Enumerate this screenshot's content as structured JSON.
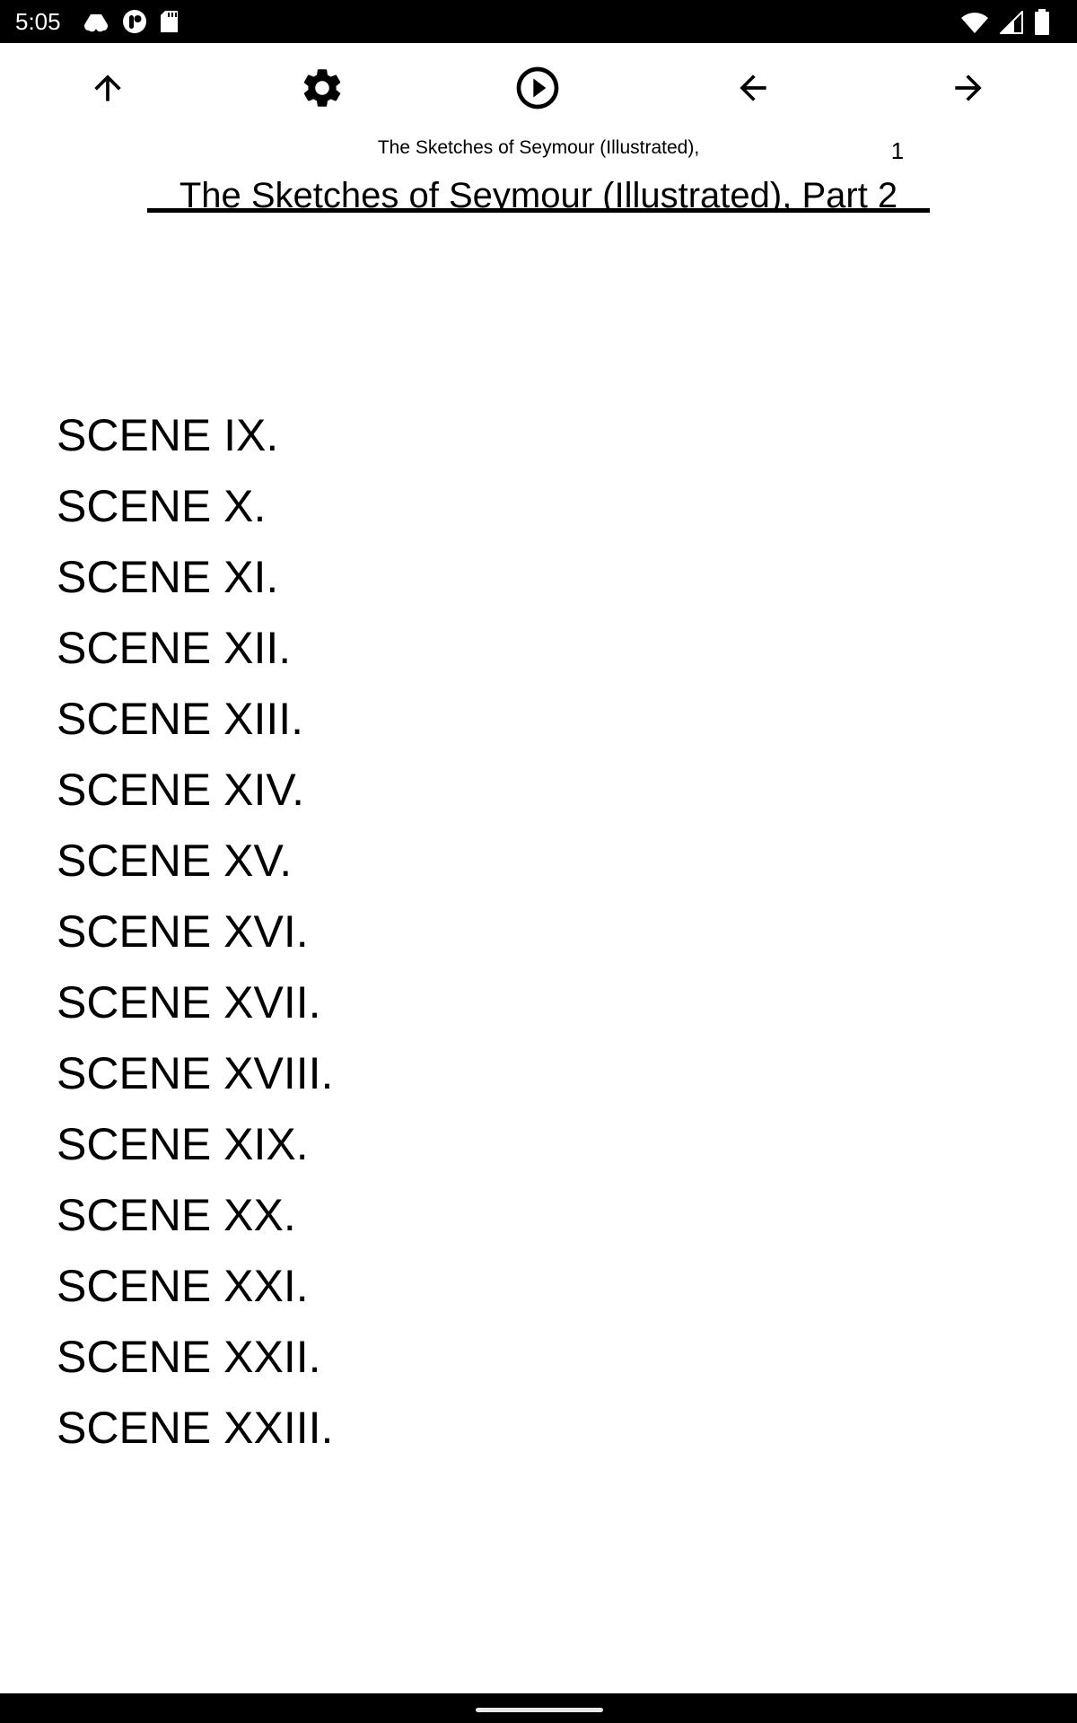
{
  "status_bar": {
    "time": "5:05",
    "left_icons": [
      "drive-icon",
      "app-notification-icon",
      "sd-card-icon"
    ],
    "right_icons": [
      "wifi-icon",
      "cellular-signal-icon",
      "battery-icon"
    ]
  },
  "toolbar": {
    "buttons": [
      {
        "name": "up-button",
        "icon": "arrow-up-icon"
      },
      {
        "name": "settings-button",
        "icon": "gear-icon"
      },
      {
        "name": "play-button",
        "icon": "play-circle-icon"
      },
      {
        "name": "previous-button",
        "icon": "arrow-left-icon"
      },
      {
        "name": "next-button",
        "icon": "arrow-right-icon"
      }
    ]
  },
  "header": {
    "book_title": "The Sketches of Seymour (Illustrated), Part 2",
    "page_number": "1"
  },
  "chapter": {
    "title": "The Sketches of Seymour (Illustrated), Part 2"
  },
  "scenes": [
    "SCENE IX.",
    "SCENE X.",
    "SCENE XI.",
    "SCENE XII.",
    "SCENE XIII.",
    "SCENE XIV.",
    "SCENE XV.",
    "SCENE XVI.",
    "SCENE XVII.",
    "SCENE XVIII.",
    "SCENE XIX.",
    "SCENE XX.",
    "SCENE XXI.",
    "SCENE XXII.",
    "SCENE XXIII."
  ]
}
